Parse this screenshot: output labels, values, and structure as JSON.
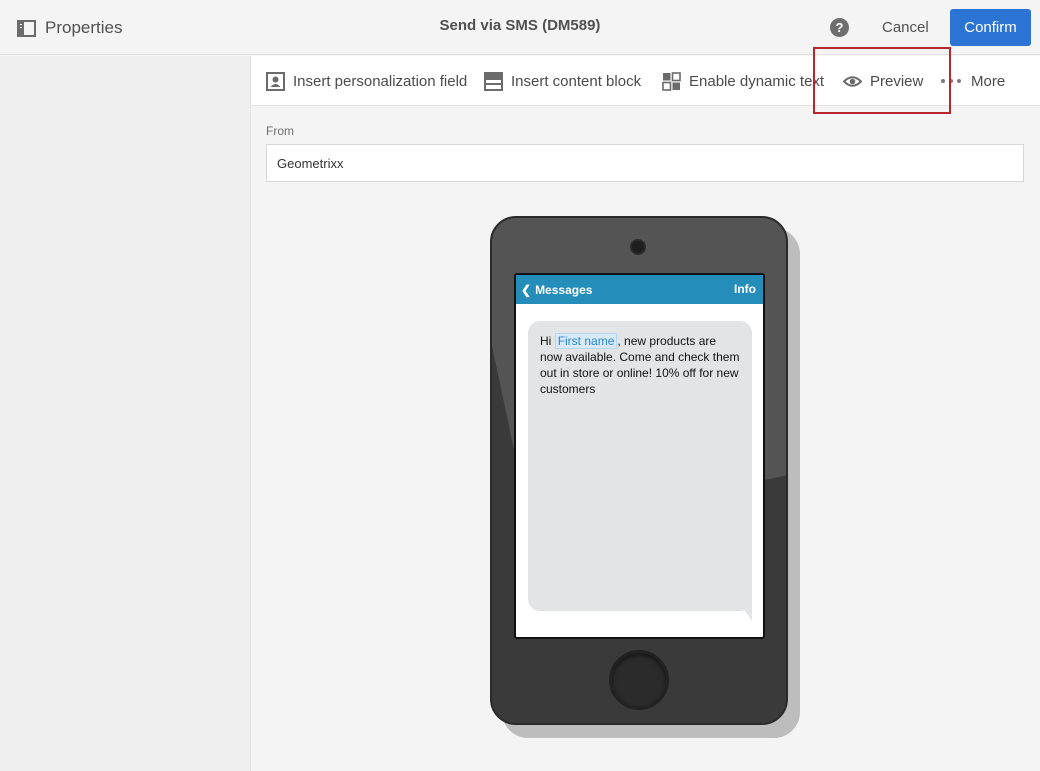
{
  "header": {
    "properties_label": "Properties",
    "title": "Send via SMS (DM589)",
    "help_label": "?",
    "cancel_label": "Cancel",
    "confirm_label": "Confirm"
  },
  "toolbar": {
    "insert_personalization_label": "Insert personalization field",
    "insert_content_block_label": "Insert content block",
    "enable_dynamic_text_label": "Enable dynamic text",
    "preview_label": "Preview",
    "more_label": "More"
  },
  "form": {
    "from_label": "From",
    "from_value": "Geometrixx"
  },
  "phone": {
    "nav_back_label": "Messages",
    "nav_info_label": "Info",
    "message": {
      "greeting": "Hi",
      "personalization_field": "First name",
      "body": ", new products are now available. Come and check them out in store or online! 10% off for new customers"
    }
  },
  "colors": {
    "confirm_bg": "#2b74d4",
    "nav_bar_bg": "#258dba",
    "highlight_border": "#b6262b",
    "personalization_text": "#2a86d1"
  }
}
